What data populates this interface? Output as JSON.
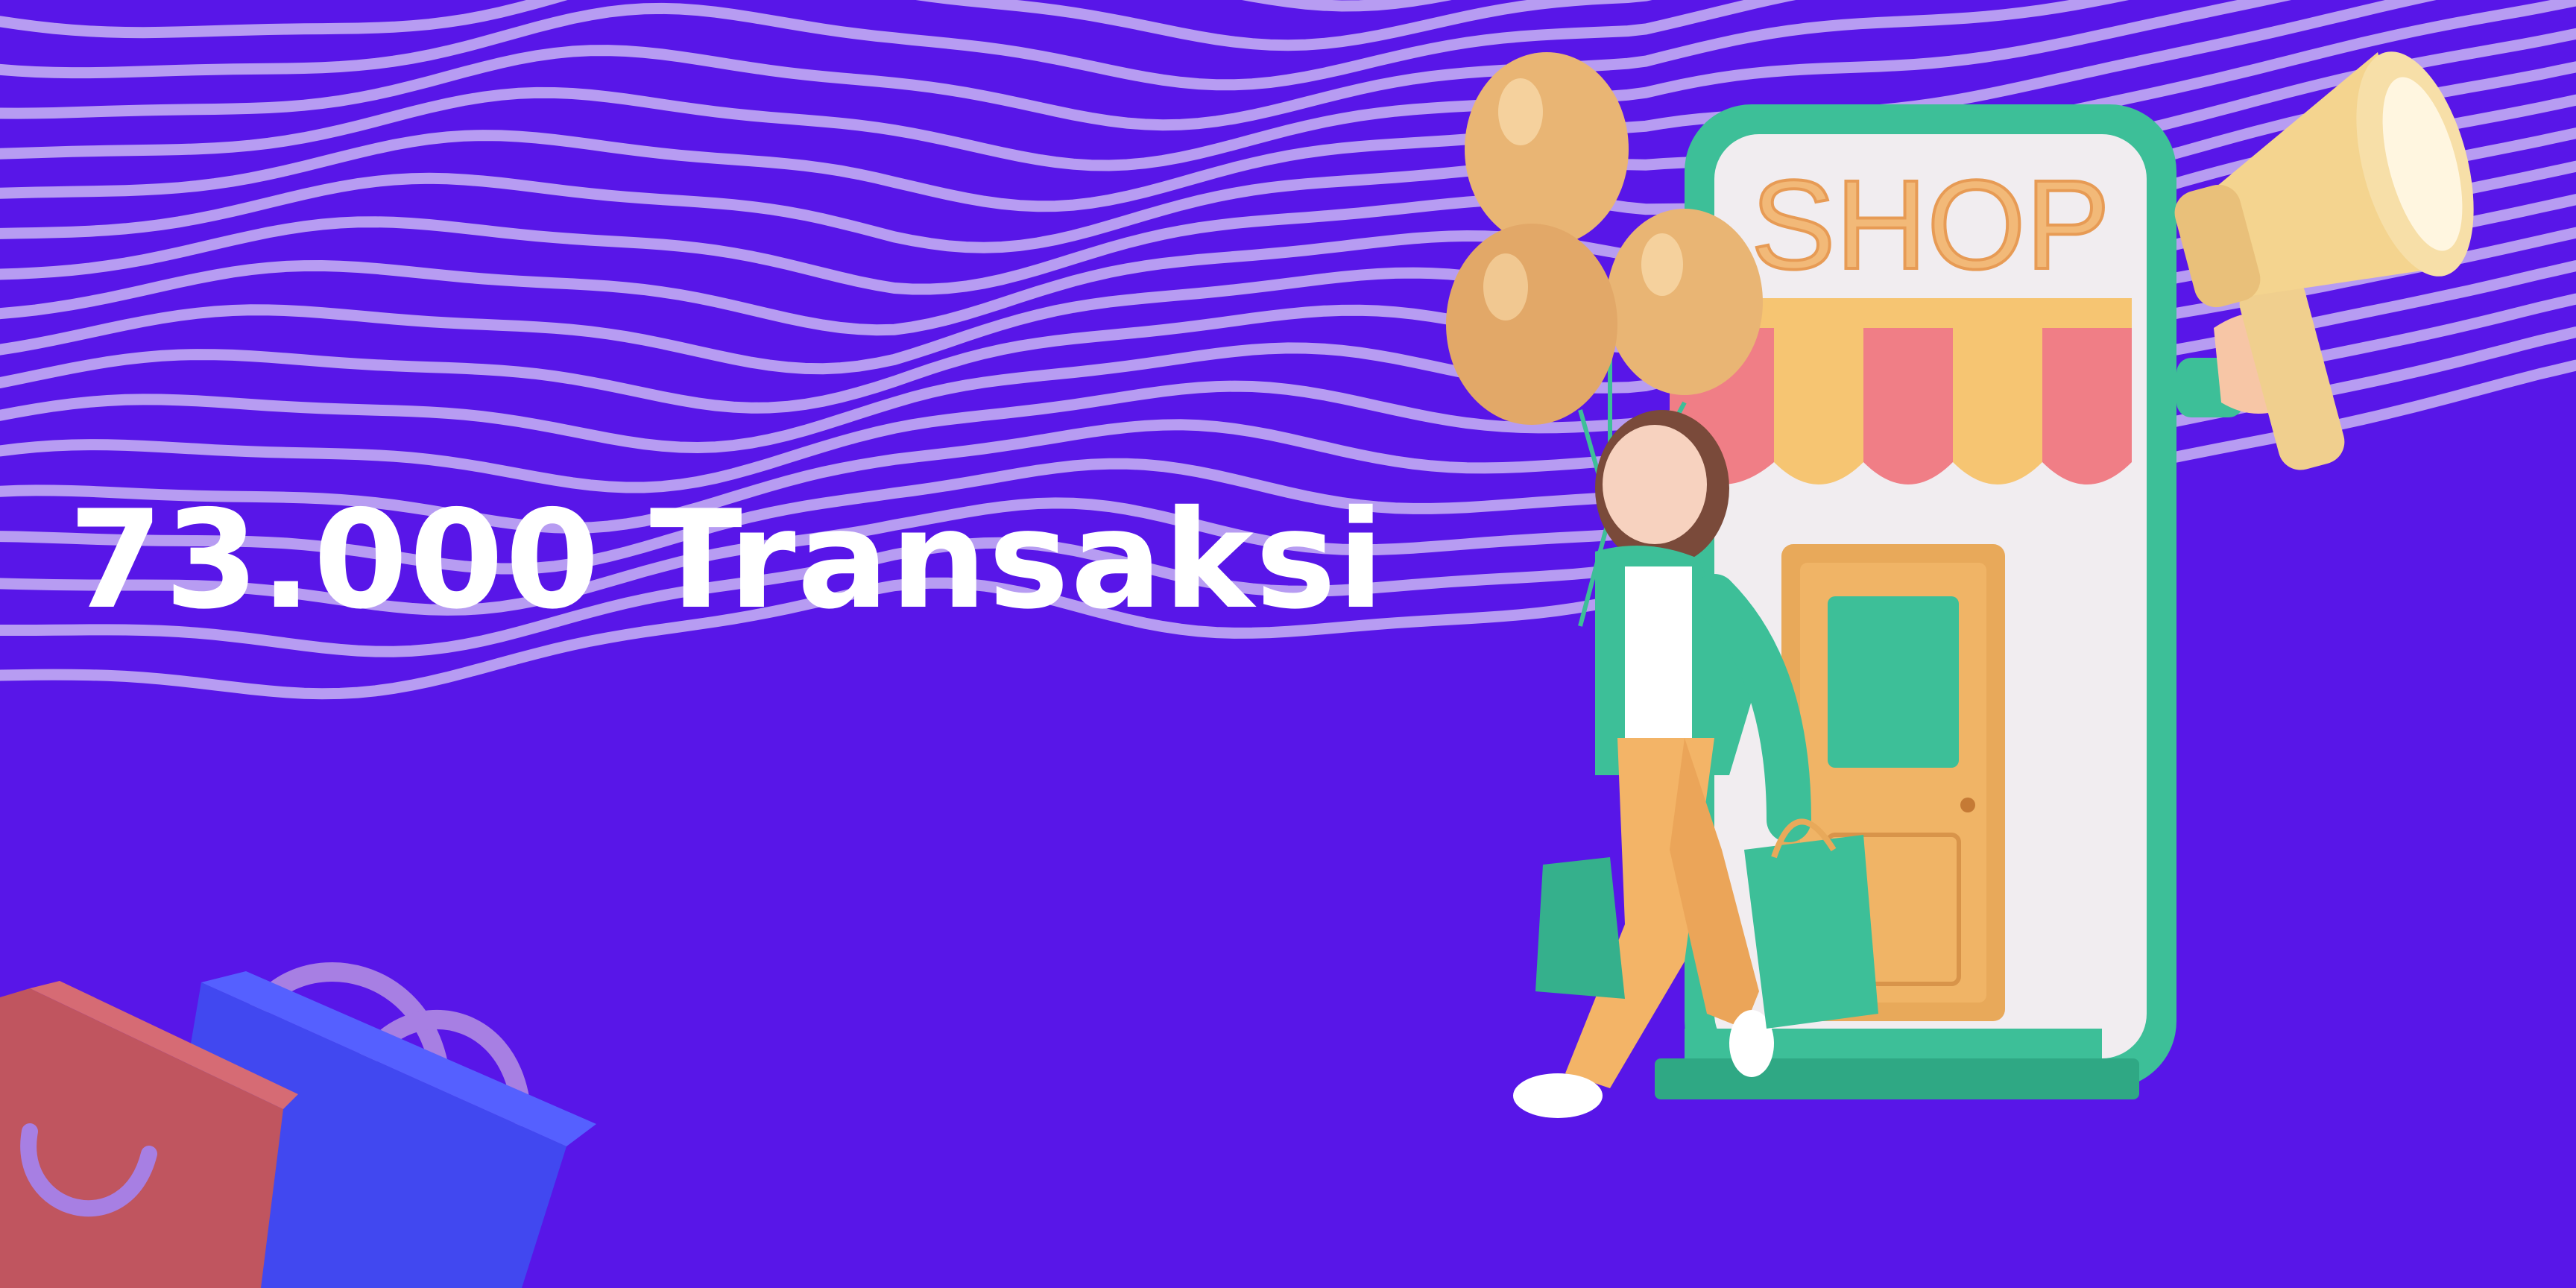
{
  "banner": {
    "headline": "73.000 Transaksi",
    "shop_sign": "SHOP"
  },
  "icons": [
    "wavy-stripes-pattern",
    "shopping-bag-icon",
    "balloon-icon",
    "shop-storefront-icon",
    "megaphone-icon"
  ],
  "colors": {
    "background": "#5816e8",
    "stripes": "#b79cf2",
    "headline": "#ffffff",
    "phone_frame": "#3dbf98",
    "awning_pink": "#f07e86",
    "awning_yellow": "#f6c572",
    "balloon": "#e9b574",
    "door": "#e8a95a",
    "bag_pink": "#c0555f",
    "bag_blue": "#4148f0"
  }
}
